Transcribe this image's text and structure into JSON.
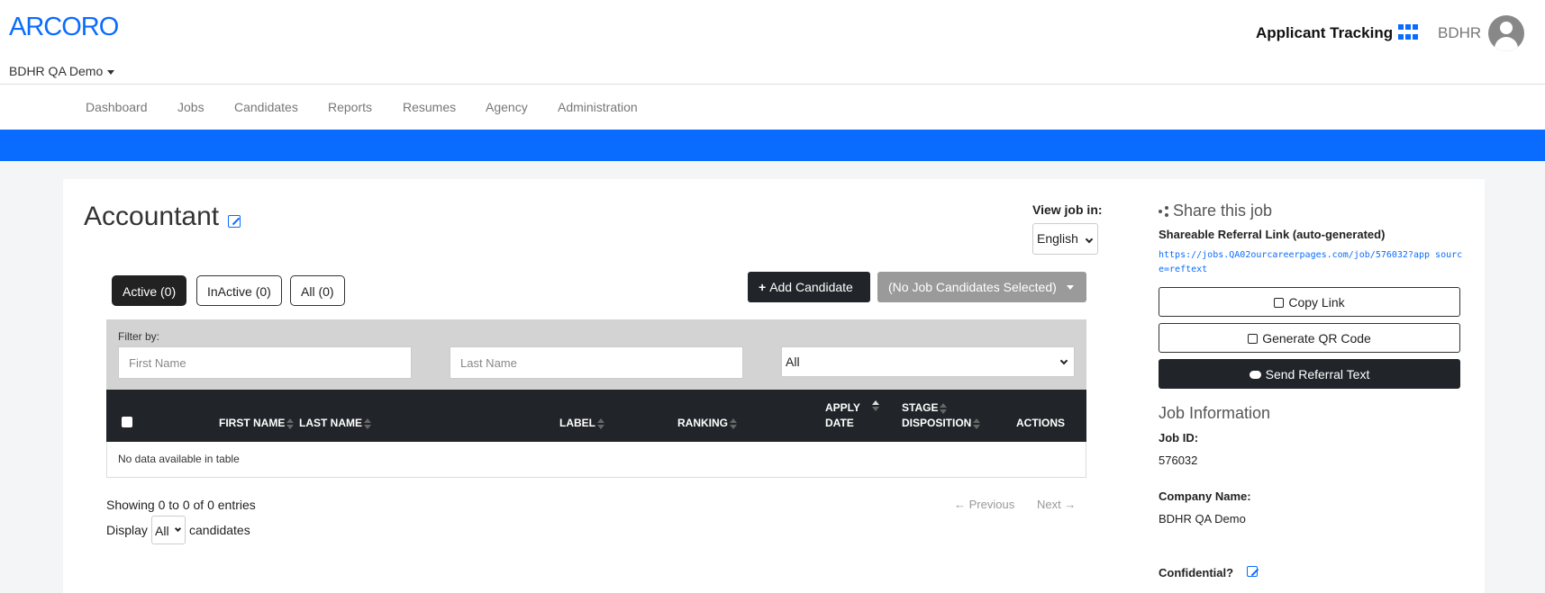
{
  "header": {
    "logo": "ARCORO",
    "org": "BDHR QA Demo",
    "app_title": "Applicant Tracking",
    "user": "BDHR"
  },
  "nav": {
    "items": [
      "Dashboard",
      "Jobs",
      "Candidates",
      "Reports",
      "Resumes",
      "Agency",
      "Administration"
    ]
  },
  "job": {
    "title": "Accountant",
    "view_label": "View job in:",
    "language": "English"
  },
  "tabs": [
    "Active (0)",
    "InActive (0)",
    "All (0)"
  ],
  "actions": {
    "add_candidate": "Add Candidate",
    "selected": "(No Job Candidates Selected)"
  },
  "filter": {
    "label": "Filter by:",
    "first_name_placeholder": "First Name",
    "last_name_placeholder": "Last Name",
    "status": "All"
  },
  "table": {
    "headers": {
      "first_name": "FIRST NAME",
      "last_name": "LAST NAME",
      "label": "LABEL",
      "ranking": "RANKING",
      "apply_date_1": "APPLY",
      "apply_date_2": "DATE",
      "stage_1": "STAGE",
      "stage_2": "DISPOSITION",
      "actions": "ACTIONS"
    },
    "empty": "No data available in table",
    "showing": "Showing 0 to 0 of 0 entries",
    "display_label": "Display",
    "display_value": "All",
    "display_suffix": "candidates",
    "previous": "← Previous",
    "next": "Next →"
  },
  "sidebar": {
    "share_title": "Share this job",
    "referral_label": "Shareable Referral Link (auto-generated)",
    "referral_link": "https://jobs.QA02ourcareerpages.com/job/576032?app source=reftext",
    "copy_link": "Copy Link",
    "qr_code": "Generate QR Code",
    "send_text": "Send Referral Text",
    "job_info_title": "Job Information",
    "job_id_label": "Job ID:",
    "job_id": "576032",
    "company_label": "Company Name:",
    "company": "BDHR QA Demo",
    "confidential_label": "Confidential?"
  },
  "colors": {
    "brand_blue": "#0a6cff",
    "dark": "#212529",
    "filter_bg": "#d3d3d3"
  }
}
